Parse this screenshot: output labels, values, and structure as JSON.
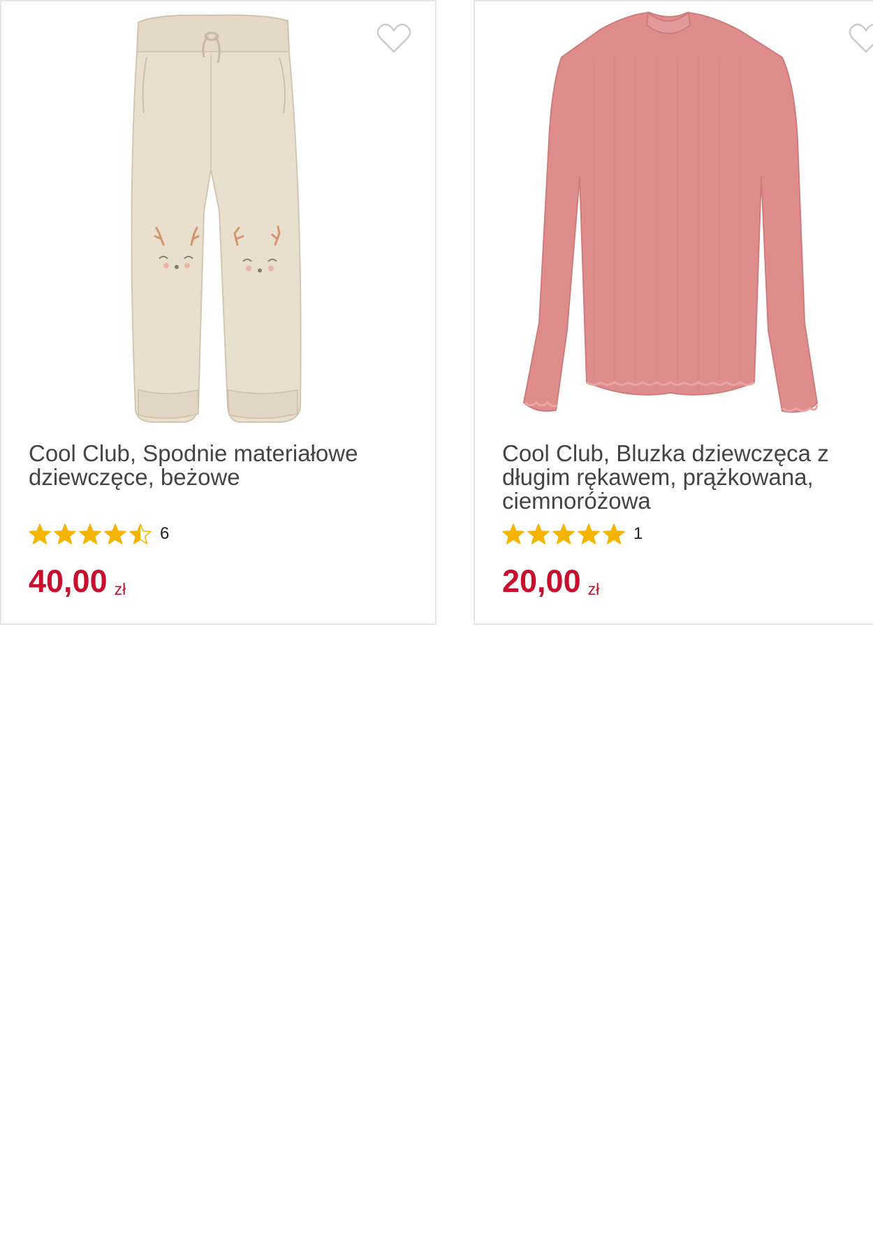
{
  "colors": {
    "price": "#c8102e",
    "star": "#f4b400",
    "title_text": "#444444",
    "card_border": "#e6e6e6"
  },
  "products": [
    {
      "title": "Cool Club, Spodnie materiałowe dziewczęce, beżowe",
      "rating_value": 4.5,
      "rating_count": "6",
      "price": "40,00",
      "currency": "zł",
      "image_icon": "beige-pants-image",
      "favorite_icon": "heart-outline-icon"
    },
    {
      "title": "Cool Club, Bluzka dziewczęca z długim rękawem, prążkowana, ciemnoróżowa",
      "rating_value": 5,
      "rating_count": "1",
      "price": "20,00",
      "currency": "zł",
      "image_icon": "pink-blouse-image",
      "favorite_icon": "heart-outline-icon"
    }
  ]
}
